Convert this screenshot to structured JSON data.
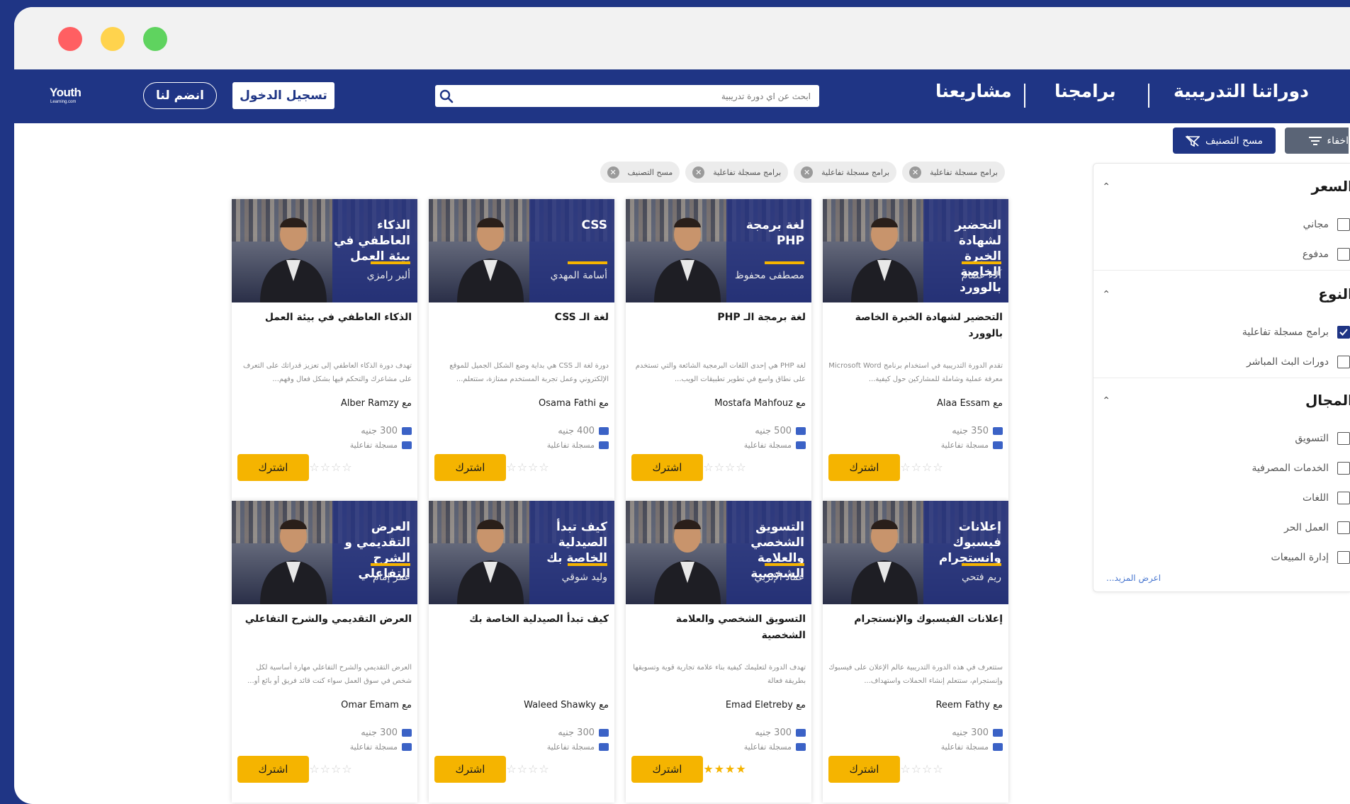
{
  "window": {
    "dots": [
      "#ff5f62",
      "#ffd34d",
      "#5fd35f"
    ]
  },
  "nav": {
    "logo_main": "Youth",
    "logo_sub": "Learning.com",
    "join_label": "انضم لنا",
    "login_label": "تسجيل الدخول",
    "search_placeholder": "ابحث عن اي دورة تدريبية",
    "menu": [
      "دوراتنا التدريبية",
      "برامجنا",
      "مشاريعنا"
    ]
  },
  "filters": {
    "hide_label": "اخفاء",
    "clear_label": "مسح التصنيف",
    "chips": [
      "برامج مسجلة تفاعلية",
      "برامج مسجلة تفاعلية",
      "برامج مسجلة تفاعلية",
      "مسح التصنيف"
    ],
    "sections": [
      {
        "title": "السعر",
        "options": [
          {
            "label": "مجاني",
            "checked": false
          },
          {
            "label": "مدفوع",
            "checked": false
          }
        ]
      },
      {
        "title": "النوع",
        "options": [
          {
            "label": "برامج مسجلة تفاعلية",
            "checked": true
          },
          {
            "label": "دورات البث المباشر",
            "checked": false
          }
        ]
      },
      {
        "title": "المجال",
        "options": [
          {
            "label": "التسويق",
            "checked": false
          },
          {
            "label": "الخدمات المصرفية",
            "checked": false
          },
          {
            "label": "اللغات",
            "checked": false
          },
          {
            "label": "العمل الحر",
            "checked": false
          },
          {
            "label": "إدارة المبيعات",
            "checked": false
          }
        ]
      }
    ],
    "show_more": "اعرض المزيد..."
  },
  "courses": [
    {
      "banner_title": "التحضير لشهادة الخبرة الخاصة بالوورد",
      "banner_name": "آلاء عصام",
      "title": "التحضير لشهادة الخبرة الخاصة بالوورد",
      "desc": "تقدم الدورة التدريبية في استخدام برنامج Microsoft Word معرفة عملية وشاملة للمشاركين حول كيفية...",
      "by": "مع Alaa Essam",
      "price": "350 جنيه",
      "type": "مسجلة تفاعلية",
      "rating": 0,
      "cta": "اشترك"
    },
    {
      "banner_title": "لغة برمجة PHP",
      "banner_name": "مصطفى محفوظ",
      "title": "لغة برمجة الـ PHP",
      "desc": "لغة PHP هي إحدى اللغات البرمجية الشائعة والتي تستخدم على نطاق واسع في تطوير تطبيقات الويب...",
      "by": "مع Mostafa Mahfouz",
      "price": "500 جنيه",
      "type": "مسجلة تفاعلية",
      "rating": 0,
      "cta": "اشترك"
    },
    {
      "banner_title": "CSS",
      "banner_name": "أسامة المهدي",
      "title": "لغة الـ CSS",
      "desc": "دورة لغة الـ CSS هي بداية وضع الشكل الجميل للموقع الإلكتروني وعمل تجربة المستخدم ممتازة، ستتعلم...",
      "by": "مع Osama Fathi",
      "price": "400 جنيه",
      "type": "مسجلة تفاعلية",
      "rating": 0,
      "cta": "اشترك"
    },
    {
      "banner_title": "الذكاء العاطفي في بيئة العمل",
      "banner_name": "ألبر رامزي",
      "title": "الذكاء العاطفي في بيئة العمل",
      "desc": "تهدف دورة الذكاء العاطفي إلى تعزيز قدراتك على التعرف على مشاعرك والتحكم فيها بشكل فعال وفهم...",
      "by": "مع Alber Ramzy",
      "price": "300 جنيه",
      "type": "مسجلة تفاعلية",
      "rating": 0,
      "cta": "اشترك"
    },
    {
      "banner_title": "إعلانات فيسبوك وانستجرام",
      "banner_name": "ريم فتحي",
      "title": "إعلانات الفيسبوك والإنستجرام",
      "desc": "ستتعرف في هذه الدورة التدريبية عالم الإعلان على فيسبوك وإنستجرام، ستتعلم إنشاء الحملات واستهداف...",
      "by": "مع Reem Fathy",
      "price": "300 جنيه",
      "type": "مسجلة تفاعلية",
      "rating": 0,
      "cta": "اشترك"
    },
    {
      "banner_title": "التسويق الشخصي والعلامة الشخصية",
      "banner_name": "عماد الإتربي",
      "title": "التسويق الشخصي والعلامة الشخصية",
      "desc": "تهدف الدورة لتعليمك كيفية بناء علامة تجارية قوية وتسويقها بطريقة فعالة",
      "by": "مع Emad Eletreby",
      "price": "300 جنيه",
      "type": "مسجلة تفاعلية",
      "rating": 5,
      "cta": "اشترك"
    },
    {
      "banner_title": "كيف تبدأ الصيدلية الخاصة بك",
      "banner_name": "وليد شوقي",
      "title": "كيف تبدأ الصيدلية الخاصة بك",
      "desc": "",
      "by": "مع Waleed Shawky",
      "price": "300 جنيه",
      "type": "مسجلة تفاعلية",
      "rating": 0,
      "cta": "اشترك"
    },
    {
      "banner_title": "العرض التقديمي و الشرح التفاعلي",
      "banner_name": "عمر إمام",
      "title": "العرض التقديمي والشرح التفاعلي",
      "desc": "العرض التقديمي والشرح التفاعلي مهارة أساسية لكل شخص في سوق العمل سواء كنت قائد فريق أو بائع أو...",
      "by": "مع Omar Emam",
      "price": "300 جنيه",
      "type": "مسجلة تفاعلية",
      "rating": 0,
      "cta": "اشترك"
    }
  ]
}
